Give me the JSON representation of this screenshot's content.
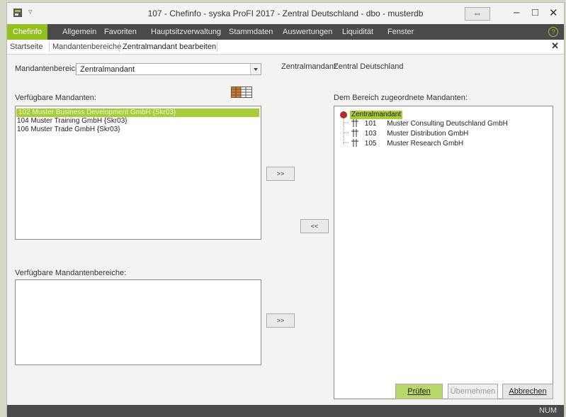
{
  "window": {
    "title": "107 - Chefinfo - syska ProFI 2017 - Zentral Deutschland - dbo - musterdb",
    "qat_glyph": "▿",
    "resize_glyph": "⇔",
    "minimize_glyph": "–",
    "maximize_glyph": "□",
    "close_glyph": "✕"
  },
  "menu": {
    "items": [
      {
        "label": "Chefinfo"
      },
      {
        "label": "Allgemein"
      },
      {
        "label": "Favoriten"
      },
      {
        "label": "Hauptsitzverwaltung"
      },
      {
        "label": "Stammdaten"
      },
      {
        "label": "Auswertungen"
      },
      {
        "label": "Liquidität"
      },
      {
        "label": "Fenster"
      }
    ],
    "help_glyph": "?"
  },
  "tabs": {
    "items": [
      {
        "label": "Startseite"
      },
      {
        "label": "Mandantenbereiche"
      },
      {
        "label": "Zentralmandant bearbeiten"
      }
    ],
    "close_glyph": "✕"
  },
  "form": {
    "range_label": "Mandantenbereich:",
    "range_value": "Zentralmandant",
    "info_key": "Zentralmandant",
    "info_value": "Zentral Deutschland",
    "available_label": "Verfügbare Mandanten:",
    "available_items": [
      {
        "text": "102  Muster Business Development GmbH {Skr03}"
      },
      {
        "text": "104  Muster Training GmbH {Skr03}"
      },
      {
        "text": "106  Muster Trade GmbH {Skr03}"
      }
    ],
    "assigned_label": "Dem Bereich zugeordnete Mandanten:",
    "tree_root": "Zentralmandant",
    "tree_children": [
      {
        "number": "101",
        "name": "Muster Consulting Deutschland GmbH"
      },
      {
        "number": "103",
        "name": "Muster Distribution GmbH"
      },
      {
        "number": "105",
        "name": "Muster Research GmbH"
      }
    ],
    "ranges_label": "Verfügbare Mandantenbereiche:",
    "add_glyph": ">>",
    "remove_glyph": "<<",
    "add_range_glyph": ">>"
  },
  "footer": {
    "check_label": "Prüfen",
    "apply_label": "Übernehmen",
    "cancel_label": "Abbrechen"
  },
  "statusbar": {
    "num": "NUM"
  },
  "colors": {
    "accent": "#93c020",
    "selection": "#a8cc3a",
    "menubar": "#4a4a4a"
  }
}
